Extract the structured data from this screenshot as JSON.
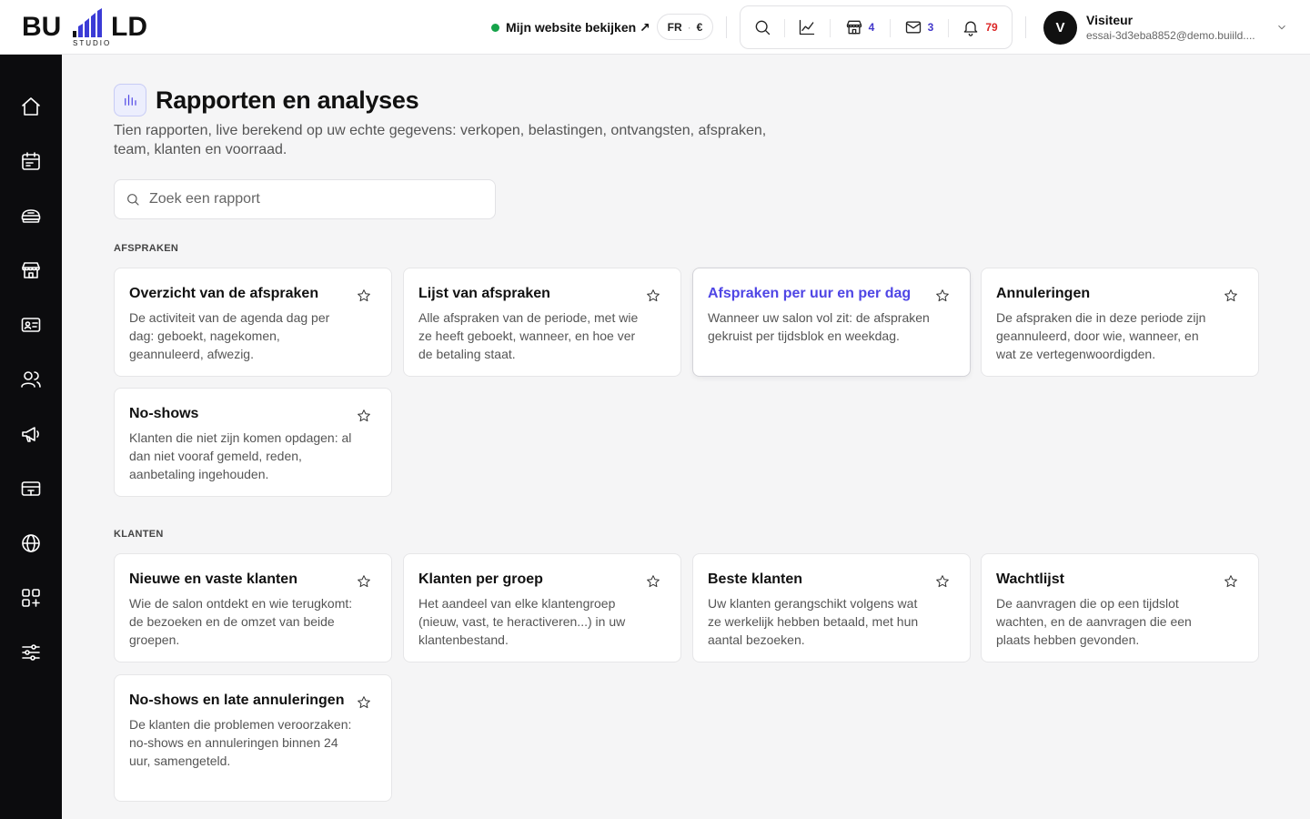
{
  "header": {
    "logo_word_left": "BU",
    "logo_word_right": "LD",
    "logo_sub": "STUDIO",
    "site_link": "Mijn website bekijken ↗",
    "lang": "FR",
    "lang_sep": "·",
    "currency": "€",
    "tools": {
      "stores_count": "4",
      "mail_count": "3",
      "notifications_count": "79"
    },
    "user": {
      "initial": "V",
      "name": "Visiteur",
      "email": "essai-3d3eba8852@demo.buiild...."
    },
    "icons": [
      "search-icon",
      "chart-icon",
      "store-icon",
      "mail-icon",
      "bell-icon",
      "chevron-down-icon"
    ]
  },
  "sidebar": {
    "icons": [
      "home-icon",
      "calendar-icon",
      "products-icon",
      "store-icon",
      "contact-card-icon",
      "users-icon",
      "megaphone-icon",
      "payment-card-icon",
      "globe-icon",
      "apps-icon",
      "settings-sliders-icon"
    ]
  },
  "main": {
    "title": "Rapporten en analyses",
    "subtitle": "Tien rapporten, live berekend op uw echte gegevens: verkopen, belastingen, ontvangsten, afspraken, team, klanten en voorraad.",
    "search_placeholder": "Zoek een rapport",
    "sections": [
      {
        "label": "AFSPRAKEN",
        "cards": [
          {
            "title": "Overzicht van de afspraken",
            "desc": "De activiteit van de agenda dag per dag: geboekt, nagekomen, geannuleerd, afwezig."
          },
          {
            "title": "Lijst van afspraken",
            "desc": "Alle afspraken van de periode, met wie ze heeft geboekt, wanneer, en hoe ver de betaling staat."
          },
          {
            "title": "Afspraken per uur en per dag",
            "desc": "Wanneer uw salon vol zit: de afspraken gekruist per tijdsblok en weekdag."
          },
          {
            "title": "Annuleringen",
            "desc": "De afspraken die in deze periode zijn geannuleerd, door wie, wanneer, en wat ze vertegenwoordigden."
          },
          {
            "title": "No-shows",
            "desc": "Klanten die niet zijn komen opdagen: al dan niet vooraf gemeld, reden, aanbetaling ingehouden."
          }
        ]
      },
      {
        "label": "KLANTEN",
        "cards": [
          {
            "title": "Nieuwe en vaste klanten",
            "desc": "Wie de salon ontdekt en wie terugkomt: de bezoeken en de omzet van beide groepen."
          },
          {
            "title": "Klanten per groep",
            "desc": "Het aandeel van elke klantengroep (nieuw, vast, te heractiveren...) in uw klantenbestand."
          },
          {
            "title": "Beste klanten",
            "desc": "Uw klanten gerangschikt volgens wat ze werkelijk hebben betaald, met hun aantal bezoeken."
          },
          {
            "title": "Wachtlijst",
            "desc": "De aanvragen die op een tijdslot wachten, en de aanvragen die een plaats hebben gevonden."
          },
          {
            "title": "No-shows en late annuleringen",
            "desc": "De klanten die problemen veroorzaken: no-shows en annuleringen binnen 24 uur, samengeteld."
          }
        ]
      }
    ]
  },
  "colors": {
    "accent": "#4f46e5",
    "sidebar": "#0c0c0e",
    "badge_blue": "#4338ca",
    "badge_red": "#dc2626",
    "online_dot": "#16a34a"
  }
}
